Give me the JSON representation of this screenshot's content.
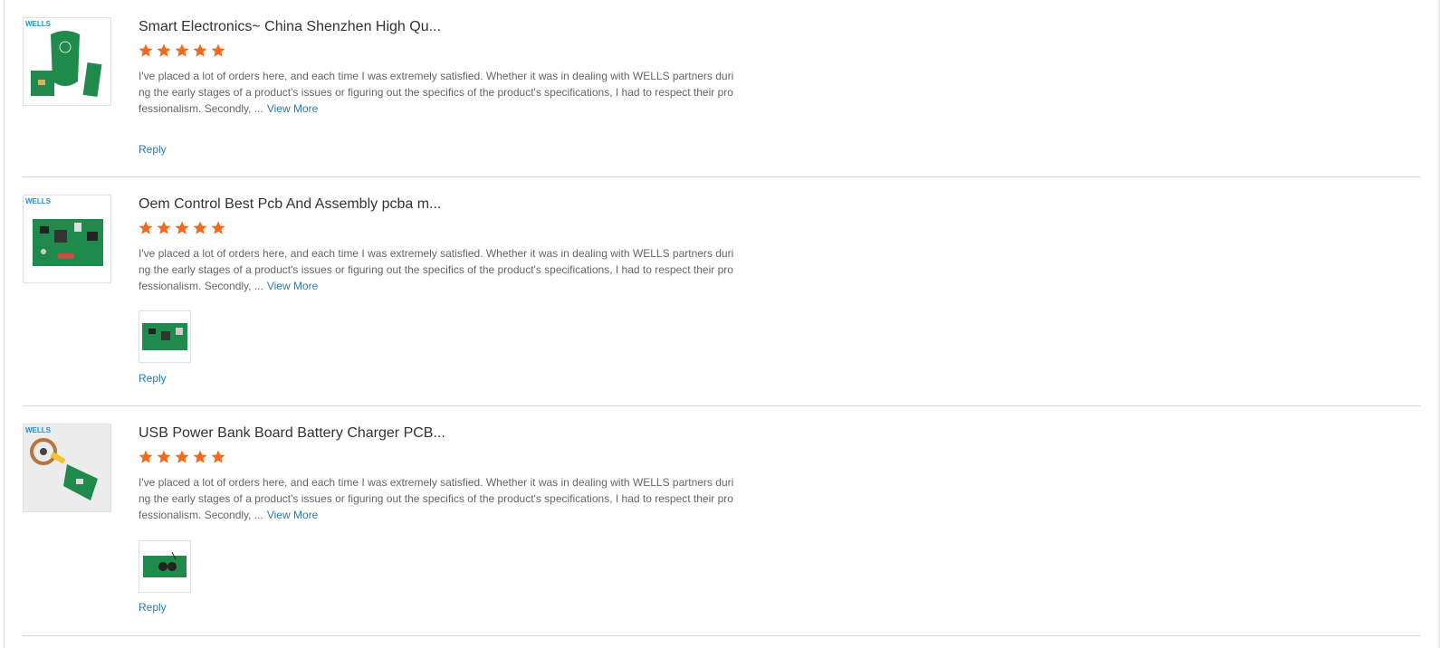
{
  "colors": {
    "star": "#f26b1d",
    "link": "#2a7ab5",
    "pcb_green": "#1f8a4c"
  },
  "reviews": [
    {
      "title": "Smart Electronics~ China Shenzhen High Qu...",
      "rating": 5,
      "text": "I've placed a lot of orders here, and each time I was extremely satisfied. Whether it was in dealing with WELLS partners during the early stages of a product's issues or figuring out the specifics of the product's specifications, I had to respect their professionalism. Secondly, ...",
      "view_more": "View More",
      "reply": "Reply",
      "logo": "WELLS",
      "has_photo": false
    },
    {
      "title": "Oem Control Best Pcb And Assembly pcba m...",
      "rating": 5,
      "text": "I've placed a lot of orders here, and each time I was extremely satisfied. Whether it was in dealing with WELLS partners during the early stages of a product's issues or figuring out the specifics of the product's specifications, I had to respect their professionalism. Secondly, ...",
      "view_more": "View More",
      "reply": "Reply",
      "logo": "WELLS",
      "has_photo": true
    },
    {
      "title": "USB Power Bank Board Battery Charger PCB...",
      "rating": 5,
      "text": "I've placed a lot of orders here, and each time I was extremely satisfied. Whether it was in dealing with WELLS partners during the early stages of a product's issues or figuring out the specifics of the product's specifications, I had to respect their professionalism. Secondly, ...",
      "view_more": "View More",
      "reply": "Reply",
      "logo": "WELLS",
      "has_photo": true
    }
  ]
}
